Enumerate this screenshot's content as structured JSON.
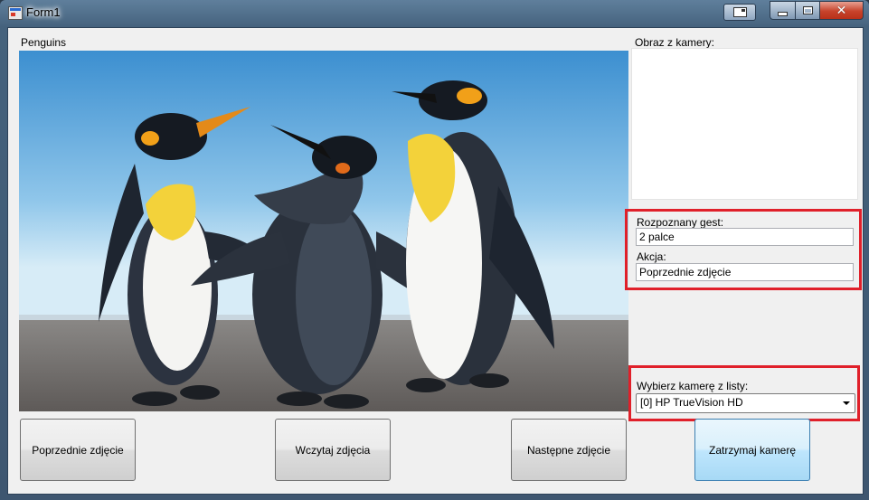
{
  "window": {
    "title": "Form1"
  },
  "labels": {
    "picture_name": "Penguins",
    "camera_image": "Obraz z kamery:",
    "recognized_gesture": "Rozpoznany gest:",
    "action": "Akcja:",
    "choose_camera": "Wybierz kamerę z listy:"
  },
  "fields": {
    "gesture_value": "2 palce",
    "action_value": "Poprzednie zdjęcie",
    "camera_selected": "[0] HP TrueVision HD"
  },
  "buttons": {
    "previous": "Poprzednie zdjęcie",
    "load": "Wczytaj zdjęcia",
    "next": "Następne zdjęcie",
    "stop_camera": "Zatrzymaj kamerę"
  },
  "icons": {
    "app": "form-icon",
    "extra": "window-list-icon",
    "minimize": "minimize-icon",
    "maximize": "maximize-icon",
    "close": "close-icon"
  },
  "colors": {
    "highlight": "#e0202a",
    "window_frame": "#45627d",
    "client_bg": "#f0f0f0"
  }
}
